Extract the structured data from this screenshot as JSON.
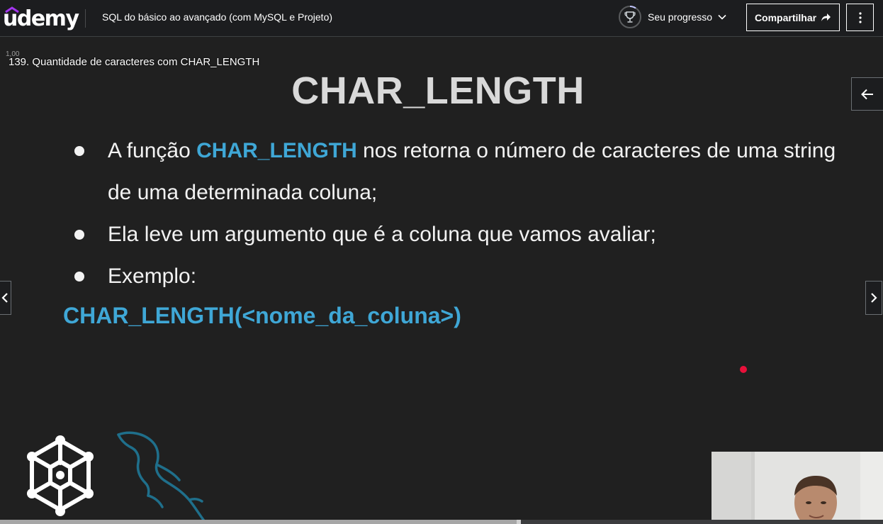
{
  "header": {
    "logo_text": "udemy",
    "course_title": "SQL do básico ao avançado (com MySQL e Projeto)",
    "progress_label": "Seu progresso",
    "share_label": "Compartilhar"
  },
  "video": {
    "speed_label": "1,00",
    "lecture_title": "139. Quantidade de caracteres com CHAR_LENGTH",
    "slide": {
      "title": "CHAR_LENGTH",
      "bullet1_prefix": "A função ",
      "bullet1_highlight": "CHAR_LENGTH",
      "bullet1_suffix": " nos retorna o número de caracteres de uma string de uma determinada coluna;",
      "bullet2": "Ela leve um argumento que é a coluna que vamos avaliar;",
      "bullet3": "Exemplo:",
      "syntax": "CHAR_LENGTH(<nome_da_coluna>)"
    },
    "progress_fraction": 0.585,
    "buffer_fraction": 0.59
  },
  "colors": {
    "accent_blue": "#3fa7d6",
    "udemy_purple": "#a435f0",
    "indicator_red": "#e8103a"
  }
}
